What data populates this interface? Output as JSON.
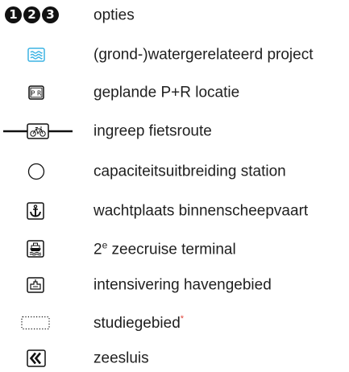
{
  "legend": {
    "items": [
      {
        "numbers": [
          "1",
          "2",
          "3"
        ],
        "label": "opties"
      },
      {
        "icon": "water-icon",
        "label": "(grond-)watergerelateerd project"
      },
      {
        "icon": "parking-p-r-icon",
        "icon_text": "P R",
        "label": "geplande P+R locatie"
      },
      {
        "icon": "bicycle-route-icon",
        "label": "ingreep fietsroute"
      },
      {
        "icon": "circle-station-icon",
        "label": "capaciteitsuitbreiding station"
      },
      {
        "icon": "anchor-icon",
        "label": "wachtplaats binnenscheepvaart"
      },
      {
        "icon": "ship-icon",
        "label_prefix": "2",
        "label_sup": "e",
        "label_rest": " zeecruise terminal"
      },
      {
        "icon": "harbour-crane-icon",
        "label": "intensivering havengebied"
      },
      {
        "icon": "dotted-study-area-icon",
        "label": "studiegebied",
        "marker": "*"
      },
      {
        "icon": "sea-lock-icon",
        "label": "zeesluis"
      }
    ]
  },
  "colors": {
    "water_blue": "#3db4e4",
    "asterisk_red": "#e0463c",
    "icon_black": "#111111"
  }
}
